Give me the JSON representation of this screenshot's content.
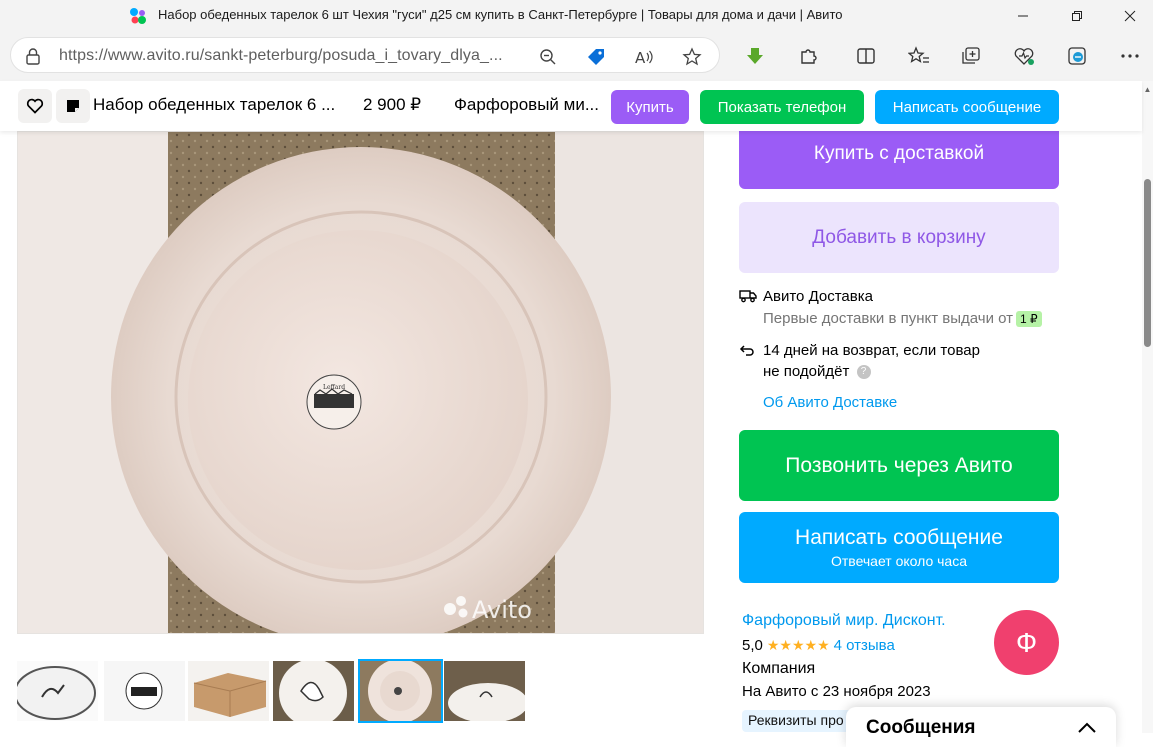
{
  "browser": {
    "window_title": "Набор обеденных тарелок 6 шт Чехия \"гуси\" д25 см купить в Санкт-Петербурге | Товары для дома и дачи | Авито",
    "url_host": "https://www.avito.ru",
    "url_path": "/sankt-peterburg/posuda_i_tovary_dlya_...",
    "minimize_icon": "minimize-icon",
    "maximize_icon": "restore-icon",
    "close_icon": "close-icon"
  },
  "sticky_bar": {
    "title": "Набор обеденных тарелок 6 ...",
    "price": "2 900 ₽",
    "seller": "Фарфоровый ми...",
    "buy_label": "Купить",
    "show_phone_label": "Показать телефон",
    "write_message_label": "Написать сообщение"
  },
  "gallery": {
    "watermark": "Avito",
    "thumbnail_count": 6,
    "selected_index": 4
  },
  "purchase": {
    "buy_delivery_label": "Купить с доставкой",
    "add_to_cart_label": "Добавить в корзину",
    "delivery_title": "Авито Доставка",
    "delivery_note": "Первые доставки в пункт выдачи от",
    "delivery_badge": "1 ₽",
    "return_line1": "14 дней на возврат, если товар",
    "return_line2": "не подойдёт",
    "about_delivery_link": "Об Авито Доставке",
    "call_label": "Позвонить через Авито",
    "message_label": "Написать сообщение",
    "message_sub": "Отвечает около часа"
  },
  "seller": {
    "name": "Фарфоровый мир. Дисконт.",
    "rating": "5,0",
    "stars": "★★★★★",
    "reviews": "4 отзыва",
    "type": "Компания",
    "since": "На Авито с 23 ноября 2023",
    "details_chip": "Реквизиты про",
    "avatar_letter": "Ф"
  },
  "messages": {
    "title": "Сообщения"
  },
  "colors": {
    "purple": "#9b5cf6",
    "purple_light": "#ece4fd",
    "green": "#00c452",
    "blue": "#00aaff",
    "avatar": "#f0406e"
  }
}
